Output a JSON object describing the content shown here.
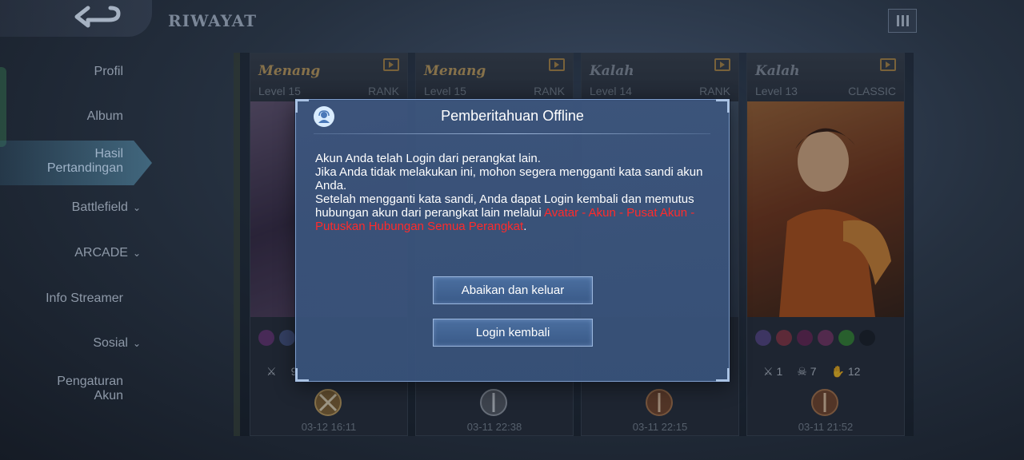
{
  "header": {
    "title": "RIWAYAT"
  },
  "sidebar": {
    "items": [
      {
        "label": "Profil",
        "has_chevron": false
      },
      {
        "label": "Album",
        "has_chevron": false
      },
      {
        "label": "Hasil\nPertandingan",
        "has_chevron": false,
        "active": true
      },
      {
        "label": "Battlefield",
        "has_chevron": true
      },
      {
        "label": "ARCADE",
        "has_chevron": true
      },
      {
        "label": "Info Streamer",
        "has_chevron": false
      },
      {
        "label": "Sosial",
        "has_chevron": true
      },
      {
        "label": "Pengaturan\nAkun",
        "has_chevron": false
      }
    ],
    "chevron": "⌄"
  },
  "matches": [
    {
      "result": "Menang",
      "level": "Level 15",
      "mode": "RANK",
      "kills": "9",
      "date": "03-12 16:11",
      "result_color": "#c9a766"
    },
    {
      "result": "Menang",
      "level": "Level 15",
      "mode": "RANK",
      "date": "03-11 22:38",
      "result_color": "#c9a766"
    },
    {
      "result": "Kalah",
      "level": "Level 14",
      "mode": "RANK",
      "date": "03-11 22:15",
      "result_color": "#8d97a6"
    },
    {
      "result": "Kalah",
      "level": "Level 13",
      "mode": "CLASSIC",
      "kills": "1",
      "deaths": "7",
      "assists": "12",
      "date": "03-11 21:52",
      "result_color": "#8d97a6"
    }
  ],
  "modal": {
    "title": "Pemberitahuan Offline",
    "line1": "Akun Anda telah Login dari perangkat lain.",
    "line2": "Jika Anda tidak melakukan ini, mohon segera mengganti kata sandi akun Anda.",
    "line3_prefix": "Setelah mengganti kata sandi, Anda dapat Login kembali dan memutus hubungan akun dari perangkat lain melalui ",
    "line3_link": "Avatar - Akun - Pusat Akun - Putuskan Hubungan Semua Perangkat",
    "line3_suffix": ".",
    "button_ignore": "Abaikan dan keluar",
    "button_relogin": "Login kembali"
  },
  "colors": {
    "accent_red": "#ff2b2b",
    "win_gold": "#c9a766",
    "modal_bg": "#3d5983"
  }
}
